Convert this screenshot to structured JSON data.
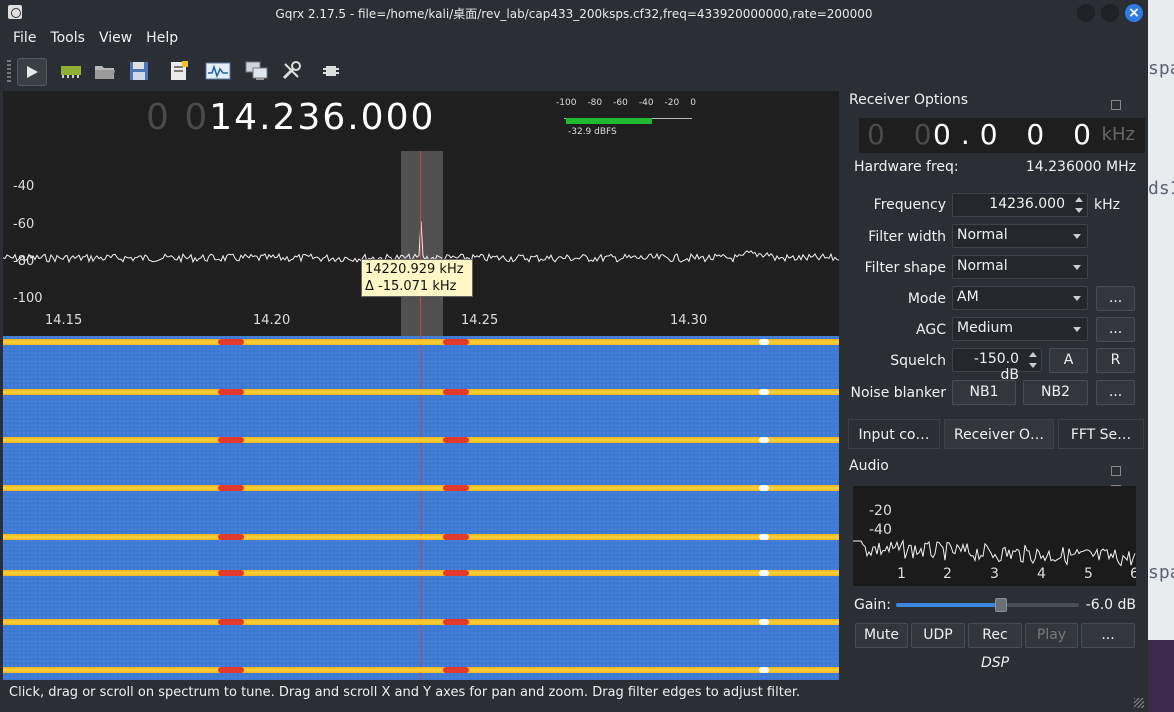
{
  "window": {
    "title": "Gqrx 2.17.5 - file=/home/kali/桌面/rev_lab/cap433_200ksps.cf32,freq=433920000000,rate=200000"
  },
  "menu": [
    "File",
    "Tools",
    "View",
    "Help"
  ],
  "toolbar": {
    "icons": [
      "play-icon",
      "hardware-icon",
      "open-file-icon",
      "save-icon",
      "bookmark-icon",
      "spectrum-icon",
      "remote-control-icon",
      "settings-icon",
      "dsp-chip-icon"
    ]
  },
  "spectrum": {
    "freq_dim": "0 0",
    "freq_bright": "14.236.000",
    "meter_scale": [
      "-100",
      "-80",
      "-60",
      "-40",
      "-20",
      "0"
    ],
    "meter_value": "-32.9 dBFS",
    "meter_level_dbfs": -32.9,
    "y_labels": [
      "-40",
      "-60",
      "-80",
      "-100"
    ],
    "x_labels": [
      "14.15",
      "14.20",
      "14.25",
      "14.30"
    ],
    "tooltip_line1": "14220.929 kHz",
    "tooltip_line2": "Δ -15.071 kHz"
  },
  "status": "Click, drag or scroll on spectrum to tune. Drag and scroll X and Y axes for pan and zoom. Drag filter edges to adjust filter.",
  "receiver": {
    "title": "Receiver Options",
    "lcd_dim": "0 0",
    "lcd_bright": "0.0 0 0",
    "lcd_unit": "kHz",
    "hw_label": "Hardware freq:",
    "hw_value": "14.236000 MHz",
    "frequency_label": "Frequency",
    "frequency_value": "14236.000",
    "frequency_unit": "kHz",
    "filter_width_label": "Filter width",
    "filter_width_value": "Normal",
    "filter_shape_label": "Filter shape",
    "filter_shape_value": "Normal",
    "mode_label": "Mode",
    "mode_value": "AM",
    "agc_label": "AGC",
    "agc_value": "Medium",
    "squelch_label": "Squelch",
    "squelch_value": "-150.0 dB",
    "squelch_a": "A",
    "squelch_r": "R",
    "nb_label": "Noise blanker",
    "nb1": "NB1",
    "nb2": "NB2",
    "more": "..."
  },
  "tabs": [
    "Input co…",
    "Receiver O…",
    "FFT Se…"
  ],
  "audio": {
    "title": "Audio",
    "y_labels": [
      "-20",
      "-40"
    ],
    "x_labels": [
      "1",
      "2",
      "3",
      "4",
      "5",
      "6"
    ],
    "gain_label": "Gain:",
    "gain_value": "-6.0 dB",
    "gain_fraction": 0.57,
    "buttons": [
      "Mute",
      "UDP",
      "Rec",
      "Play",
      "..."
    ],
    "dsp": "DSP"
  },
  "desktop_text": [
    "spa",
    "ds1",
    "spa"
  ]
}
